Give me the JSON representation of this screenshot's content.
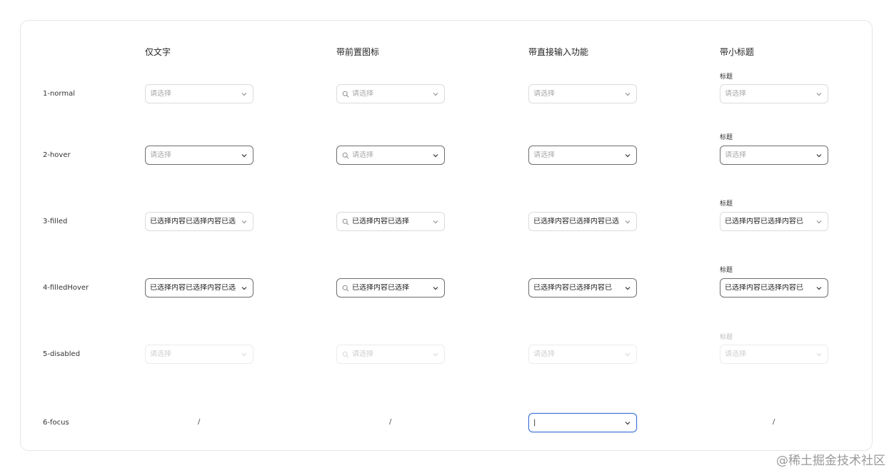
{
  "columns": [
    "仅文字",
    "带前置图标",
    "带直接输入功能",
    "带小标题"
  ],
  "rows": [
    "1-normal",
    "2-hover",
    "3-filled",
    "4-filledHover",
    "5-disabled",
    "6-focus"
  ],
  "small_title": "标题",
  "placeholder": "请选择",
  "values": {
    "text_only_filled": "已选择内容已选择内容已选",
    "prefix_filled": "已选择内容已选择",
    "input_filled": "已选择内容已选择内容已选",
    "input_filled_hover": "已选择内容已选择内容已",
    "titled_filled": "已选择内容已选择内容已",
    "text_only_filled_hover": "已选择内容已选择内容已选"
  },
  "focus": {
    "cursor": "|",
    "slash": "/"
  },
  "colors": {
    "focus_border": "#3b6fd8",
    "hover_border": "#6e6e6e",
    "default_border": "#dcdcdc",
    "placeholder": "#a8a8a8"
  },
  "icons": {
    "chevron": "chevron-down-icon",
    "prefix": "search-icon"
  },
  "watermark": "@稀土掘金技术社区"
}
